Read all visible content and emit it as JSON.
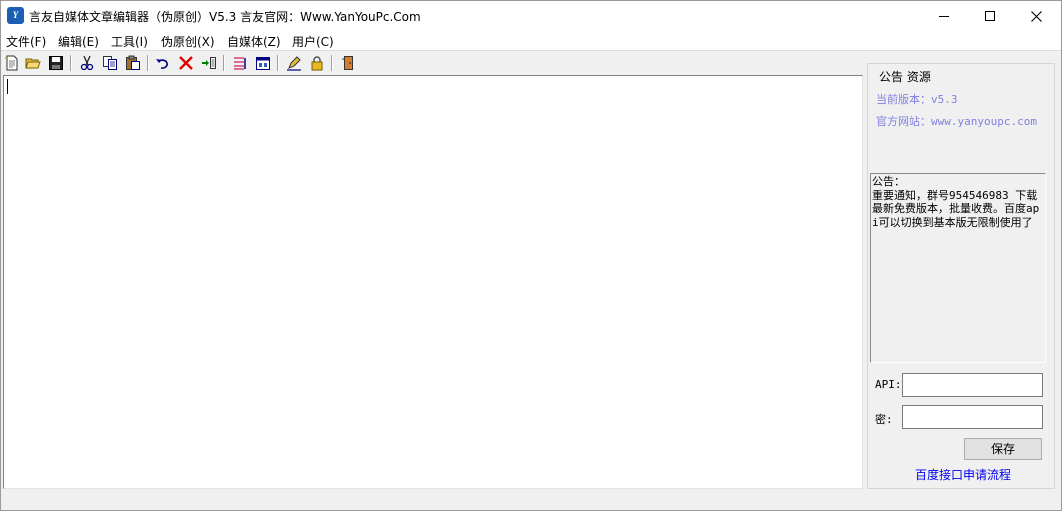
{
  "window": {
    "title": "言友自媒体文章编辑器（伪原创）V5.3 言友官网：Www.YanYouPc.Com",
    "icon_text": "Y"
  },
  "menu": {
    "items": [
      "文件(F)",
      "编辑(E)",
      "工具(I)",
      "伪原创(X)",
      "自媒体(Z)",
      "用户(C)"
    ]
  },
  "toolbar": {
    "buttons": [
      "new-file-icon",
      "open-folder-icon",
      "save-disk-icon",
      "cut-scissors-icon",
      "copy-icon",
      "paste-icon",
      "undo-icon",
      "delete-x-icon",
      "insert-icon",
      "list-icon",
      "calendar-icon",
      "edit-pen-icon",
      "lock-icon",
      "exit-door-icon"
    ]
  },
  "editor": {
    "content": ""
  },
  "panel": {
    "legend": "公告 资源",
    "version_label": "当前版本：",
    "version_value": "v5.3",
    "site_label": "官方网站：",
    "site_value": "www.yanyoupc.com",
    "notice": "公告：\n重要通知，群号954546983 下载最新免费版本，批量收费。百度api可以切换到基本版无限制使用了",
    "api_label": "API:",
    "key_label": "密:",
    "api_value": "",
    "key_value": "",
    "save_label": "保存",
    "apply_link": "百度接口申请流程"
  },
  "colors": {
    "panel_text": "#8080e0",
    "link": "#0000ee",
    "window_bg": "#f0f0f0"
  }
}
